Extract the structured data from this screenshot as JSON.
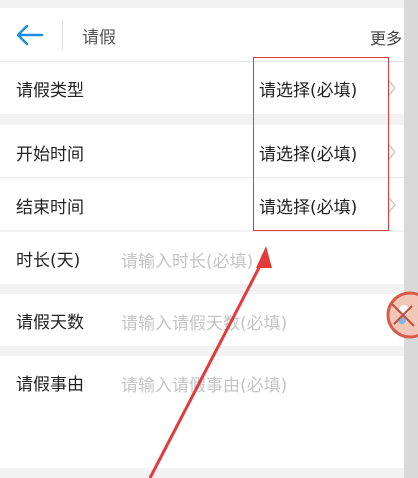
{
  "header": {
    "title": "请假",
    "more_label": "更多"
  },
  "form": {
    "rows": [
      {
        "label": "请假类型",
        "value": "请选择(必填)"
      },
      {
        "label": "开始时间",
        "value": "请选择(必填)"
      },
      {
        "label": "结束时间",
        "value": "请选择(必填)"
      },
      {
        "label": "时长(天)",
        "placeholder": "请输入时长(必填)"
      },
      {
        "label": "请假天数",
        "placeholder": "请输入请假天数(必填)"
      },
      {
        "label": "请假事由",
        "placeholder": "请输入请假事由(必填)"
      }
    ]
  },
  "colors": {
    "accent_blue": "#1a8fe3",
    "annotation_red": "#e23b3b",
    "placeholder_gray": "#c4c4c4"
  },
  "icons": [
    "back-arrow-icon",
    "chevron-right-icon",
    "floating-avatar-icon"
  ]
}
